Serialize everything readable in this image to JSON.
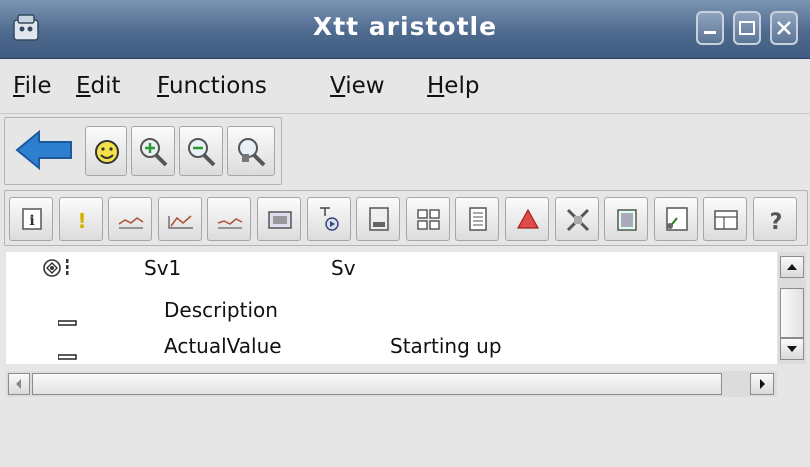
{
  "window": {
    "title": "Xtt aristotle"
  },
  "menu": [
    {
      "label": "File"
    },
    {
      "label": "Edit"
    },
    {
      "label": "Functions"
    },
    {
      "label": "View"
    },
    {
      "label": "Help"
    }
  ],
  "toolbar_main": {
    "buttons": [
      "back-arrow-icon",
      "smiley-icon",
      "zoom-in-icon",
      "zoom-out-icon",
      "zoom-reset-icon"
    ]
  },
  "toolbar_functions": {
    "buttons": [
      "object-info-icon",
      "alarm-icon",
      "trend-icon",
      "fast-curve-icon",
      "history-icon",
      "graph-icon",
      "crossreferences-icon",
      "open-class-icon",
      "plc-icon",
      "datasheet-icon",
      "warning-icon",
      "block-events-icon",
      "help-class-icon",
      "collect-icon",
      "open-object-icon",
      "help-icon"
    ]
  },
  "tree": {
    "rows": [
      {
        "icon": "object-tree-icon",
        "name": "Sv1",
        "value": "Sv"
      },
      {
        "icon": "attribute-icon",
        "name": "Description",
        "value": ""
      },
      {
        "icon": "attribute-icon",
        "name": "ActualValue",
        "value": "Starting up"
      }
    ]
  },
  "colors": {
    "titlebar": "#4e6a8f",
    "window_bg": "#e6e6e6",
    "tree_bg": "#ffffff"
  }
}
